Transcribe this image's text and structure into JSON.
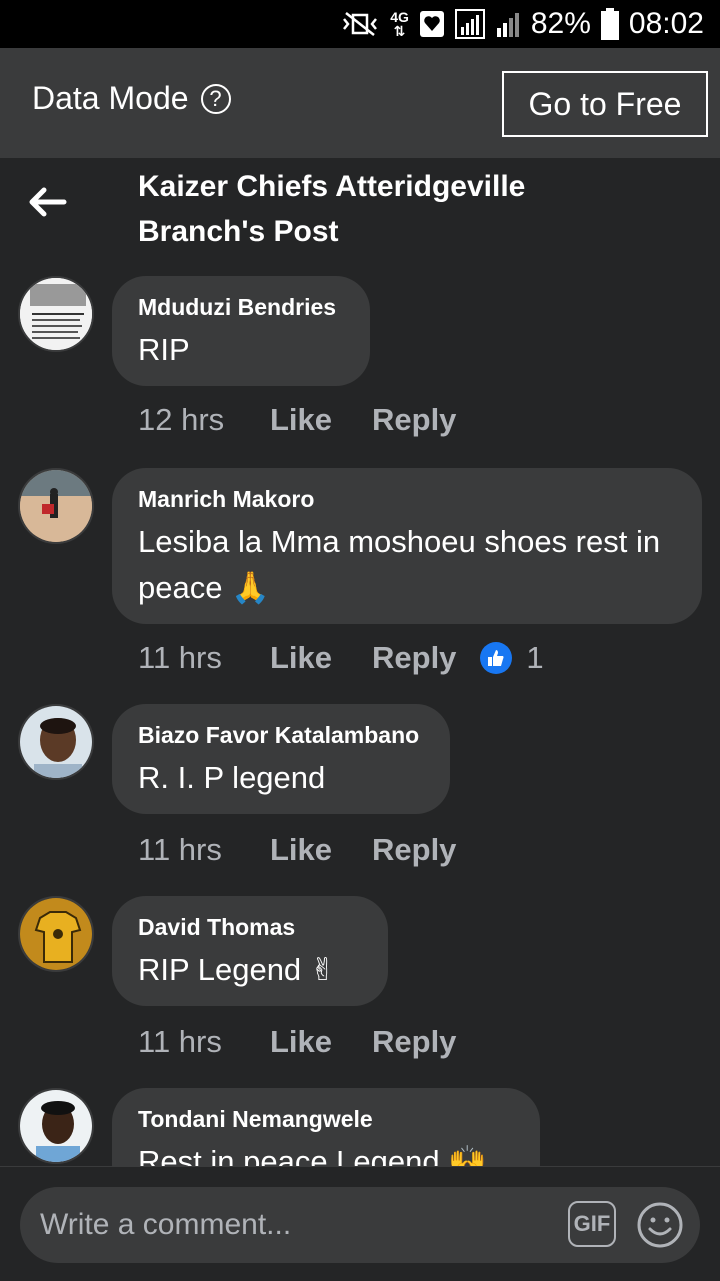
{
  "status_bar": {
    "battery_percent": "82%",
    "time": "08:02",
    "network_label": "4G"
  },
  "data_mode": {
    "label": "Data Mode",
    "help_glyph": "?",
    "go_free_label": "Go to Free"
  },
  "header": {
    "title_line1": "Kaizer Chiefs Atteridgeville",
    "title_line2": "Branch's Post"
  },
  "comments": [
    {
      "name": "Mduduzi Bendries",
      "text": "RIP",
      "time": "12 hrs",
      "like": "Like",
      "reply": "Reply"
    },
    {
      "name": "Manrich Makoro",
      "text": "Lesiba la Mma moshoeu shoes rest in peace 🙏",
      "time": "11 hrs",
      "like": "Like",
      "reply": "Reply",
      "reaction_count": "1"
    },
    {
      "name": "Biazo Favor Katalambano",
      "text": "R. I. P legend",
      "time": "11 hrs",
      "like": "Like",
      "reply": "Reply"
    },
    {
      "name": "David Thomas",
      "text": "RIP Legend ✌",
      "time": "11 hrs",
      "like": "Like",
      "reply": "Reply"
    },
    {
      "name": "Tondani Nemangwele",
      "text": "Rest in peace Legend 🙌",
      "time": "",
      "like": "",
      "reply": ""
    }
  ],
  "composer": {
    "placeholder": "Write a comment...",
    "gif_label": "GIF"
  },
  "colors": {
    "background": "#242526",
    "bubble": "#3a3b3c",
    "like_blue": "#1877f2"
  }
}
